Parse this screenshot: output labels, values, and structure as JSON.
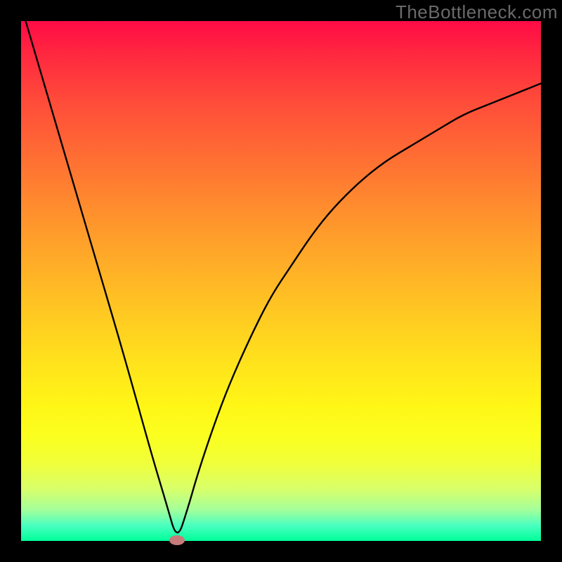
{
  "watermark": "TheBottleneck.com",
  "chart_data": {
    "type": "line",
    "title": "",
    "xlabel": "",
    "ylabel": "",
    "xlim": [
      0,
      1
    ],
    "ylim": [
      0,
      1
    ],
    "series": [
      {
        "name": "curve",
        "x": [
          0.0,
          0.05,
          0.1,
          0.15,
          0.2,
          0.25,
          0.28,
          0.3,
          0.32,
          0.34,
          0.37,
          0.4,
          0.44,
          0.48,
          0.52,
          0.56,
          0.6,
          0.65,
          0.7,
          0.75,
          0.8,
          0.85,
          0.9,
          0.95,
          1.0
        ],
        "y": [
          1.03,
          0.86,
          0.69,
          0.52,
          0.35,
          0.17,
          0.07,
          0.0,
          0.06,
          0.13,
          0.22,
          0.3,
          0.39,
          0.47,
          0.53,
          0.59,
          0.64,
          0.69,
          0.73,
          0.76,
          0.79,
          0.82,
          0.84,
          0.86,
          0.88
        ]
      }
    ],
    "marker": {
      "x": 0.3,
      "y": 0.002
    },
    "gradient_note": "background is a vertical rainbow gradient from red (top) to green (bottom), representing bottleneck severity"
  }
}
